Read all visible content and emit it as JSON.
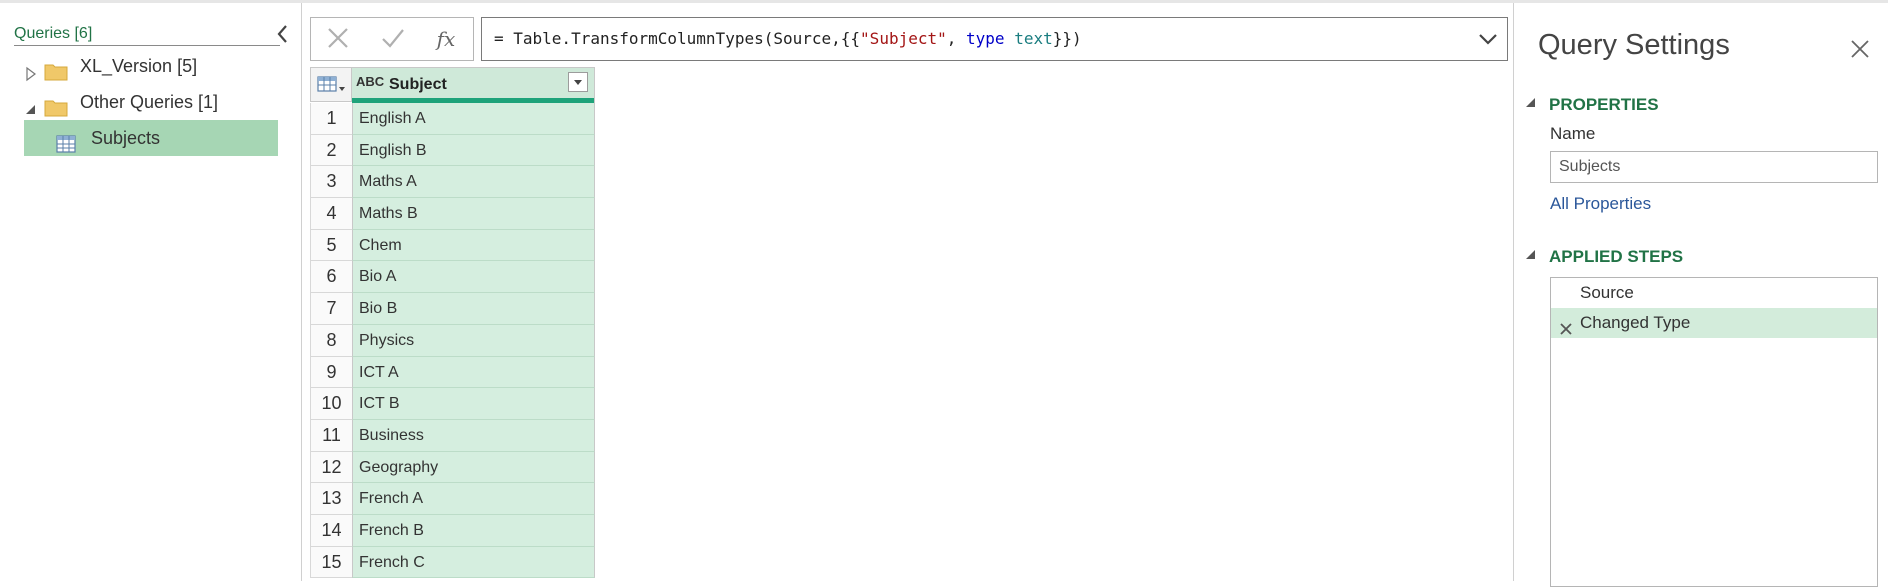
{
  "queries_pane": {
    "title": "Queries [6]",
    "tree": [
      {
        "label": "XL_Version [5]",
        "type": "group",
        "expanded": false
      },
      {
        "label": "Other Queries [1]",
        "type": "group",
        "expanded": true
      },
      {
        "label": "Subjects",
        "type": "table",
        "selected": true
      }
    ]
  },
  "formula_bar": {
    "prefix": "= Table.TransformColumnTypes(Source,{{",
    "string": "\"Subject\"",
    "sep": ", ",
    "keyword": "type",
    "space": " ",
    "type_name": "text",
    "suffix": "}})",
    "fx_label": "fx"
  },
  "grid": {
    "type_icon": "ABC",
    "column_header": "Subject",
    "rows": [
      {
        "n": "1",
        "v": "English A"
      },
      {
        "n": "2",
        "v": "English B"
      },
      {
        "n": "3",
        "v": "Maths A"
      },
      {
        "n": "4",
        "v": "Maths B"
      },
      {
        "n": "5",
        "v": "Chem"
      },
      {
        "n": "6",
        "v": "Bio A"
      },
      {
        "n": "7",
        "v": "Bio B"
      },
      {
        "n": "8",
        "v": "Physics"
      },
      {
        "n": "9",
        "v": "ICT A"
      },
      {
        "n": "10",
        "v": "ICT B"
      },
      {
        "n": "11",
        "v": "Business"
      },
      {
        "n": "12",
        "v": "Geography"
      },
      {
        "n": "13",
        "v": "French A"
      },
      {
        "n": "14",
        "v": "French B"
      },
      {
        "n": "15",
        "v": "French C"
      }
    ]
  },
  "settings": {
    "title": "Query Settings",
    "properties_header": "PROPERTIES",
    "name_label": "Name",
    "name_value": "Subjects",
    "all_properties": "All Properties",
    "steps_header": "APPLIED STEPS",
    "steps": [
      "Source",
      "Changed Type"
    ]
  },
  "colors": {
    "accent_green": "#217346",
    "selected_query_bg": "#a6d6b4",
    "column_bg": "#d5eedf",
    "quality_bar": "#1ea37a"
  }
}
